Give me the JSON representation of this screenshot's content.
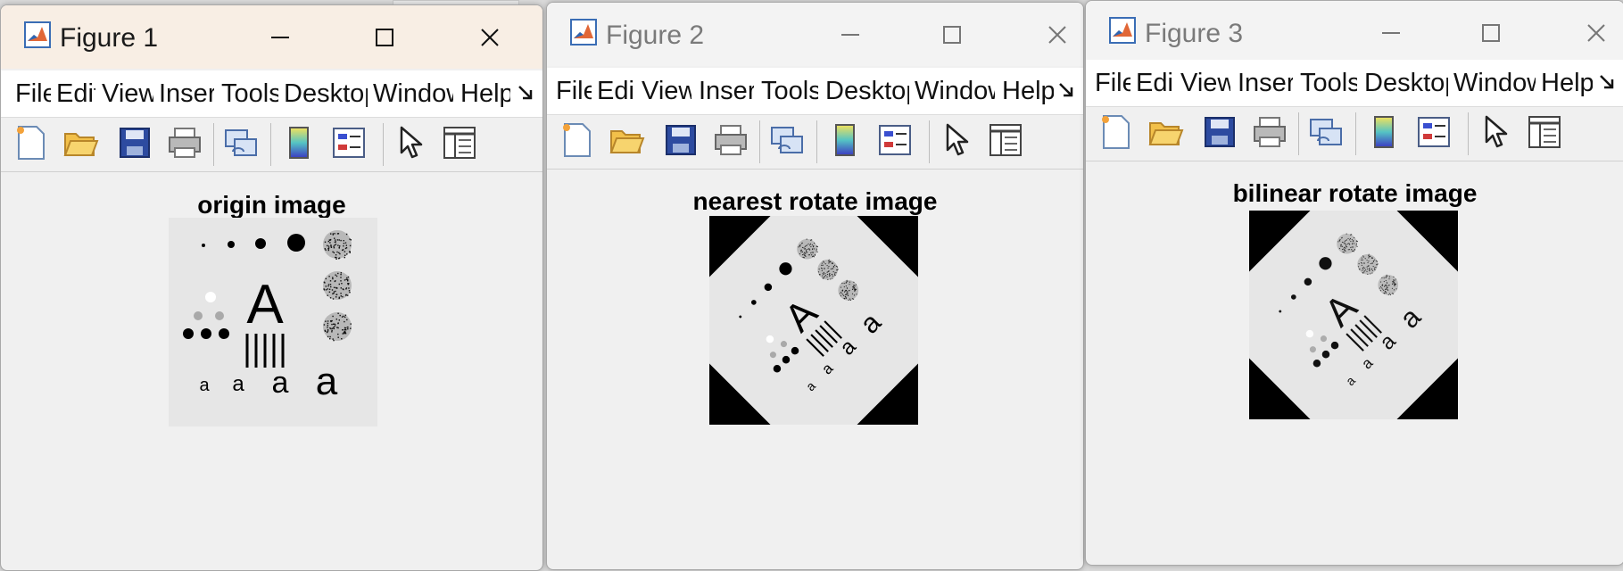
{
  "windows": [
    {
      "title": "Figure 1",
      "axes_title": "origin image",
      "active": true
    },
    {
      "title": "Figure 2",
      "axes_title": "nearest rotate image",
      "active": false
    },
    {
      "title": "Figure 3",
      "axes_title": "bilinear rotate image",
      "active": false
    }
  ],
  "menu": [
    "File",
    "Edit",
    "View",
    "Insert",
    "Tools",
    "Desktop",
    "Window",
    "Help"
  ],
  "toolbar_icons": [
    "new-figure-icon",
    "open-file-icon",
    "save-icon",
    "print-icon",
    "link-plot-icon",
    "insert-colorbar-icon",
    "insert-legend-icon",
    "edit-plot-pointer-icon",
    "property-inspector-icon"
  ],
  "image_text": {
    "big": "A",
    "small": "a"
  },
  "colors": {
    "titlebar_active": "#f8eee4",
    "window_bg": "#f0f0f0",
    "image_bg": "#e6e6e6",
    "matlab_orange": "#e16737",
    "matlab_blue": "#2b65b4"
  }
}
